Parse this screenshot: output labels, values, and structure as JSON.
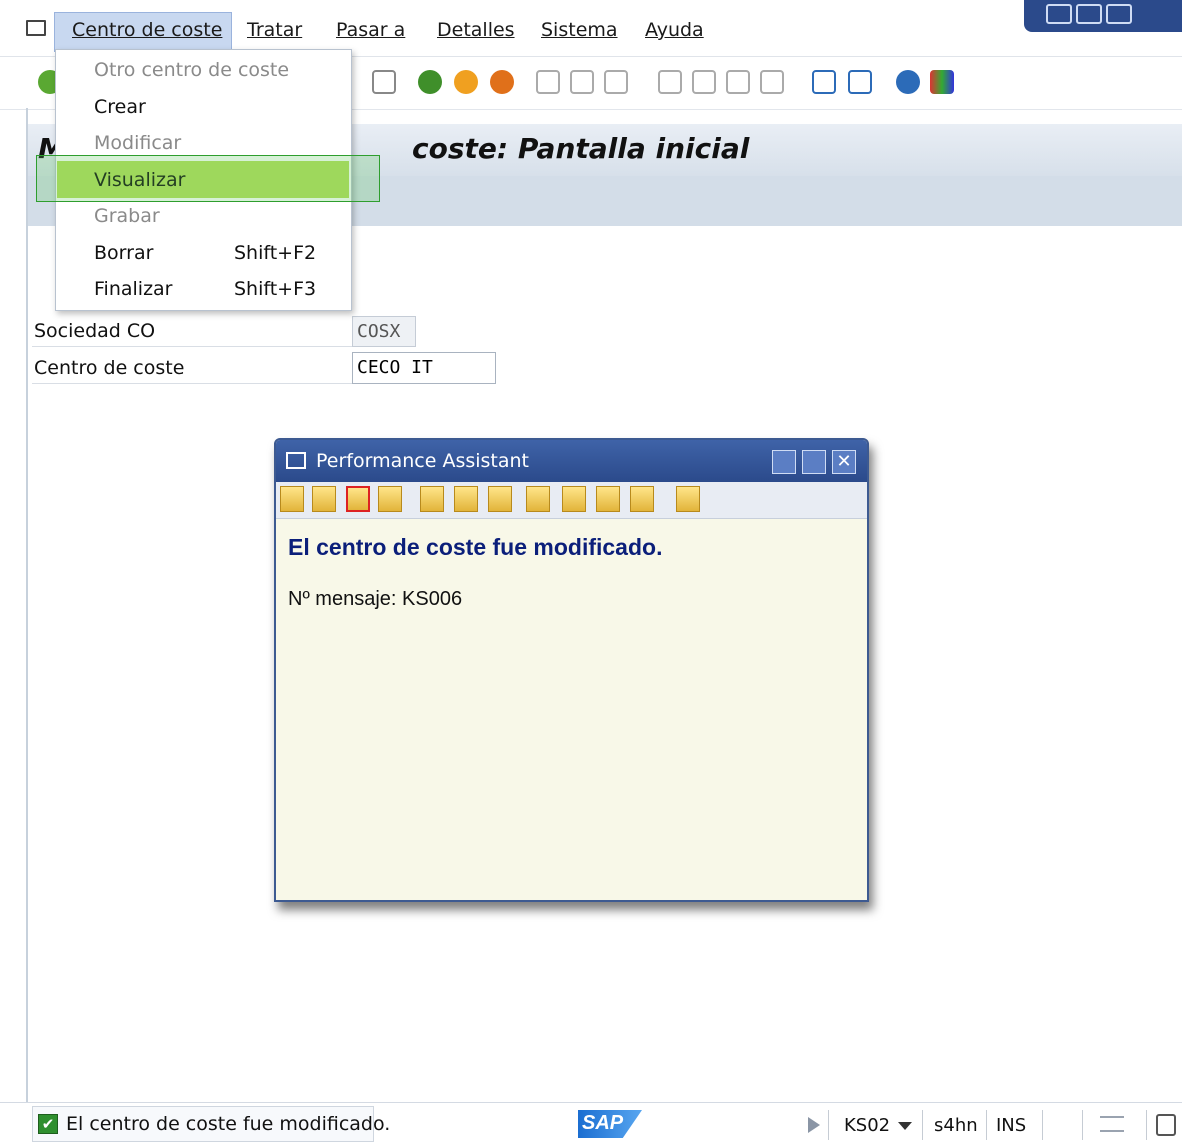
{
  "menubar": {
    "items": [
      "Centro de coste",
      "Tratar",
      "Pasar a",
      "Detalles",
      "Sistema",
      "Ayuda"
    ]
  },
  "title": {
    "text": "coste: Pantalla inicial",
    "prefix_partial": "M"
  },
  "dropdown": {
    "items": [
      {
        "label": "Otro centro de coste",
        "shortcut": "",
        "enabled": false
      },
      {
        "label": "Crear",
        "shortcut": "",
        "enabled": true
      },
      {
        "label": "Modificar",
        "shortcut": "",
        "enabled": false
      },
      {
        "label": "Visualizar",
        "shortcut": "",
        "enabled": true,
        "highlighted": true
      },
      {
        "label": "Grabar",
        "shortcut": "",
        "enabled": false
      },
      {
        "label": "Borrar",
        "shortcut": "Shift+F2",
        "enabled": true
      },
      {
        "label": "Finalizar",
        "shortcut": "Shift+F3",
        "enabled": true
      }
    ]
  },
  "form": {
    "sociedad_label": "Sociedad CO",
    "sociedad_value": "COSX",
    "centro_label": "Centro de coste",
    "centro_value": "CECO IT"
  },
  "performance_assistant": {
    "title": "Performance Assistant",
    "heading": "El centro de coste fue modificado.",
    "message": "Nº mensaje: KS006"
  },
  "statusbar": {
    "message": "El centro de coste fue modificado.",
    "logo": "SAP",
    "transaction": "KS02",
    "system": "s4hn",
    "mode": "INS"
  },
  "colors": {
    "highlight": "#b5de5c",
    "pa_title_bg": "#2b4a8b",
    "pa_heading": "#0b1f7a"
  }
}
